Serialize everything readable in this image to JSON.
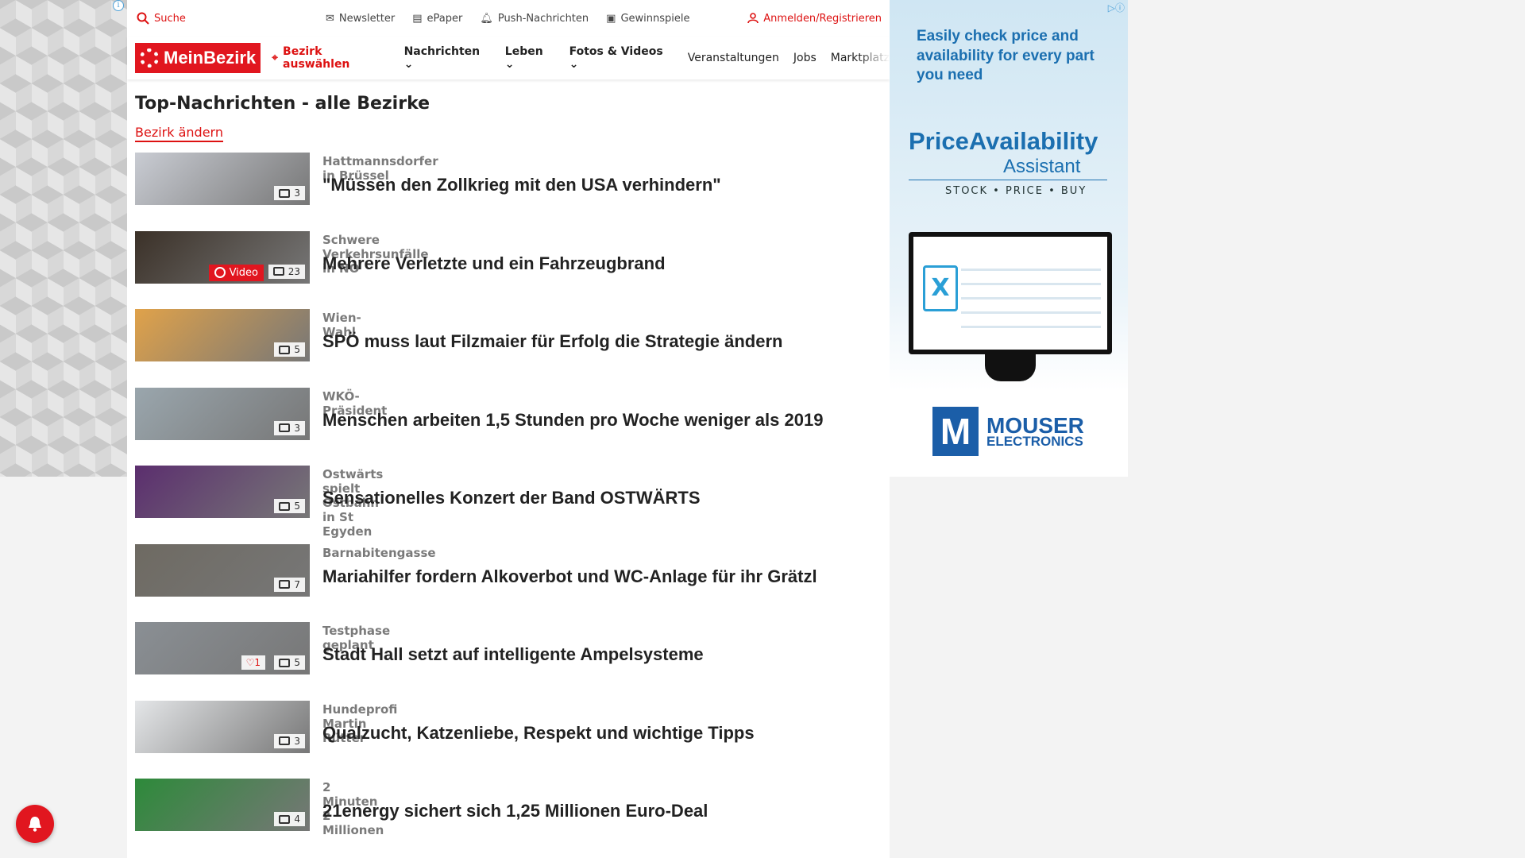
{
  "topbar": {
    "search": "Suche",
    "links": [
      "Newsletter",
      "ePaper",
      "Push-Nachrichten",
      "Gewinnspiele"
    ],
    "login": "Anmelden/Registrieren"
  },
  "nav": {
    "logo": "MeinBezirk",
    "bezirk": "Bezirk auswählen",
    "items": [
      "Nachrichten",
      "Leben",
      "Fotos & Videos",
      "Veranstaltungen",
      "Jobs",
      "Marktplatz"
    ]
  },
  "heading": "Top-Nachrichten - alle Bezirke",
  "change_link": "Bezirk ändern",
  "articles": [
    {
      "kicker": "Hattmannsdorfer in Brüssel",
      "title": "\"Müssen den Zollkrieg mit den USA verhindern\"",
      "images": "3",
      "color": "#c9ccd3"
    },
    {
      "kicker": "Schwere Verkehrsunfälle in NÖ",
      "title": "Mehrere Verletzte und ein Fahrzeugbrand",
      "images": "23",
      "video": "Video",
      "color": "#3b3128"
    },
    {
      "kicker": "Wien-Wahl",
      "title": "SPÖ muss laut Filzmaier für Erfolg die Strategie ändern",
      "images": "5",
      "color": "#e0a24a"
    },
    {
      "kicker": "WKÖ-Präsident",
      "title": "Menschen arbeiten 1,5 Stunden pro Woche weniger als 2019",
      "images": "3",
      "color": "#9aa6ad"
    },
    {
      "kicker": "Ostwärts spielt Ostbahn in St Egyden",
      "title": "Sensationelles Konzert der Band OSTWÄRTS",
      "images": "5",
      "color": "#5b2e6e"
    },
    {
      "kicker": "Barnabitengasse",
      "title": "Mariahilfer fordern Alkoverbot und WC-Anlage für ihr Grätzl",
      "images": "7",
      "color": "#6e6a62"
    },
    {
      "kicker": "Testphase geplant",
      "title": "Stadt Hall setzt auf intelligente Ampelsysteme",
      "images": "5",
      "likes": "1",
      "color": "#8a8f94"
    },
    {
      "kicker": "Hundeprofi Martin Rütter",
      "title": "Qualzucht, Katzenliebe, Respekt und wichtige Tipps",
      "images": "3",
      "color": "#e4e6e8"
    },
    {
      "kicker": "2 Minuten 2 Millionen",
      "title": "21energy sichert sich 1,25 Millionen Euro-Deal",
      "images": "4",
      "color": "#2d8a3a"
    }
  ],
  "ad": {
    "headline": "Easily check price and availability for every part you need",
    "brand": "PriceAvailability",
    "brand_sub": "Assistant",
    "tagline": "STOCK • PRICE • BUY",
    "mouser": "MOUSER",
    "mouser_sub": "ELECTRONICS"
  }
}
